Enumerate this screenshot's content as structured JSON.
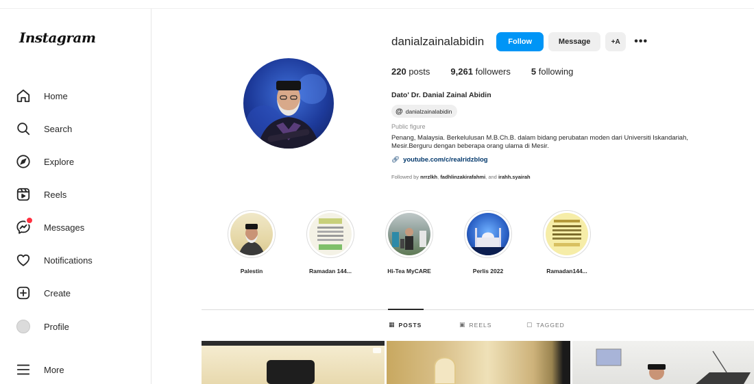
{
  "sidebar": {
    "logo": "Instagram",
    "items": [
      {
        "label": "Home",
        "icon": "home-icon"
      },
      {
        "label": "Search",
        "icon": "search-icon"
      },
      {
        "label": "Explore",
        "icon": "compass-icon"
      },
      {
        "label": "Reels",
        "icon": "reels-icon"
      },
      {
        "label": "Messages",
        "icon": "messenger-icon"
      },
      {
        "label": "Notifications",
        "icon": "heart-icon"
      },
      {
        "label": "Create",
        "icon": "plus-square-icon"
      },
      {
        "label": "Profile",
        "icon": "avatar"
      },
      {
        "label": "More",
        "icon": "hamburger-icon"
      }
    ]
  },
  "profile": {
    "username": "danialzainalabidin",
    "follow_label": "Follow",
    "message_label": "Message",
    "suggest_label": "+A",
    "more_label": "•••",
    "stats": {
      "posts_count": "220",
      "posts_label": "posts",
      "followers_count": "9,261",
      "followers_label": "followers",
      "following_count": "5",
      "following_label": "following"
    },
    "full_name": "Dato' Dr. Danial Zainal Abidin",
    "threads_handle": "danialzainalabidin",
    "category": "Public figure",
    "bio": "Penang, Malaysia. Berkelulusan M.B.Ch.B. dalam bidang perubatan moden dari Universiti Iskandariah, Mesir.Berguru dengan beberapa orang ulama di Mesir.",
    "link": "youtube.com/c/realridzblog",
    "followed_by_prefix": "Followed by",
    "followed_by_1": "nrrzlkh",
    "followed_by_2": "fadhlinzakirafahmi",
    "followed_by_and": ", and",
    "followed_by_3": "irahh.syairah"
  },
  "highlights": [
    {
      "label": "Palestin"
    },
    {
      "label": "Ramadan 144..."
    },
    {
      "label": "Hi-Tea MyCARE"
    },
    {
      "label": "Perlis 2022"
    },
    {
      "label": "Ramadan144..."
    }
  ],
  "tabs": {
    "posts": "POSTS",
    "reels": "REELS",
    "tagged": "TAGGED"
  },
  "colors": {
    "follow_button": "#0095f6",
    "secondary_button": "#efefef",
    "notification_badge": "#ff3040",
    "link": "#00376b"
  }
}
